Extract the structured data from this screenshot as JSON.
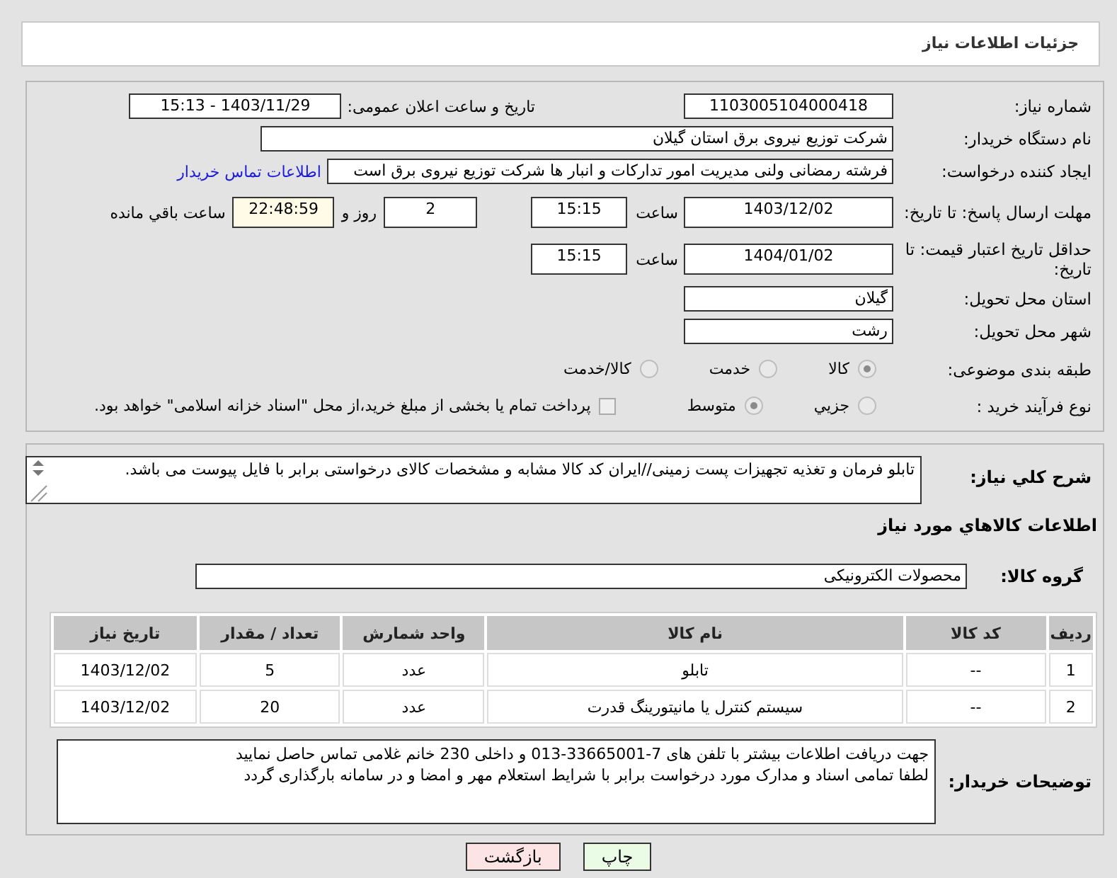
{
  "header": {
    "title": "جزئیات اطلاعات نیاز"
  },
  "need_number": {
    "label": "شماره نیاز:",
    "value": "1103005104000418"
  },
  "announce": {
    "label": "تاریخ و ساعت اعلان عمومی:",
    "value": "1403/11/29 - 15:13"
  },
  "buyer_org": {
    "label": "نام دستگاه خریدار:",
    "value": "شرکت توزیع نیروی برق استان گیلان"
  },
  "requester": {
    "label": "ایجاد کننده درخواست:",
    "value": "فرشته رمضانی ولنی مدیریت امور تدارکات و انبار ها شرکت توزیع نیروی برق است",
    "link": "اطلاعات تماس خریدار"
  },
  "reply_deadline": {
    "label": "مهلت ارسال پاسخ: تا تاریخ:",
    "date": "1403/12/02",
    "time_label": "ساعت",
    "time": "15:15",
    "days": "2",
    "days_label": "روز و",
    "remaining": "22:48:59",
    "remaining_label": "ساعت باقي مانده"
  },
  "price_validity": {
    "label": "حداقل تاریخ اعتبار قیمت: تا تاریخ:",
    "date": "1404/01/02",
    "time_label": "ساعت",
    "time": "15:15"
  },
  "province": {
    "label": "استان محل تحویل:",
    "value": "گیلان"
  },
  "city": {
    "label": "شهر محل تحویل:",
    "value": "رشت"
  },
  "classification": {
    "label": "طبقه بندی موضوعی:",
    "options": [
      {
        "label": "کالا",
        "selected": true,
        "disabled": true
      },
      {
        "label": "خدمت",
        "selected": false,
        "disabled": true
      },
      {
        "label": "کالا/خدمت",
        "selected": false,
        "disabled": true
      }
    ]
  },
  "process": {
    "label": "نوع فرآیند خرید :",
    "options": [
      {
        "label": "جزيي",
        "selected": false,
        "disabled": true
      },
      {
        "label": "متوسط",
        "selected": true,
        "disabled": true
      }
    ],
    "payment": {
      "checked": false,
      "text": "پرداخت تمام یا بخشی از مبلغ خرید،از محل \"اسناد خزانه اسلامی\" خواهد بود."
    }
  },
  "description": {
    "label": "شرح کلي نیاز:",
    "value": "تابلو فرمان و تغذیه تجهیزات پست زمینی//ایران کد کالا مشابه و مشخصات کالای درخواستی برابر با فایل پیوست می باشد."
  },
  "goods_title": "اطلاعات کالاهاي مورد نیاز",
  "goods_group": {
    "label": "گروه کالا:",
    "value": "محصولات الکترونیکی"
  },
  "table": {
    "columns": [
      "ردیف",
      "کد کالا",
      "نام کالا",
      "واحد شمارش",
      "تعداد / مقدار",
      "تاریخ نیاز"
    ],
    "rows": [
      [
        "1",
        "--",
        "تابلو",
        "عدد",
        "5",
        "1403/12/02"
      ],
      [
        "2",
        "--",
        "سیستم کنترل یا مانیتورینگ قدرت",
        "عدد",
        "20",
        "1403/12/02"
      ]
    ]
  },
  "buyer_notes": {
    "label": "توضیحات خریدار:",
    "lines": [
      "جهت دریافت اطلاعات بیشتر با تلفن های 7-33665001-013 و داخلی 230 خانم غلامی تماس حاصل نمایید",
      "لطفا تمامی اسناد و مدارک مورد درخواست برابر با شرایط استعلام مهر و امضا و در سامانه بارگذاری گردد"
    ]
  },
  "buttons": [
    {
      "label": "چاپ",
      "kind": "print"
    },
    {
      "label": "بازگشت",
      "kind": "back"
    }
  ]
}
